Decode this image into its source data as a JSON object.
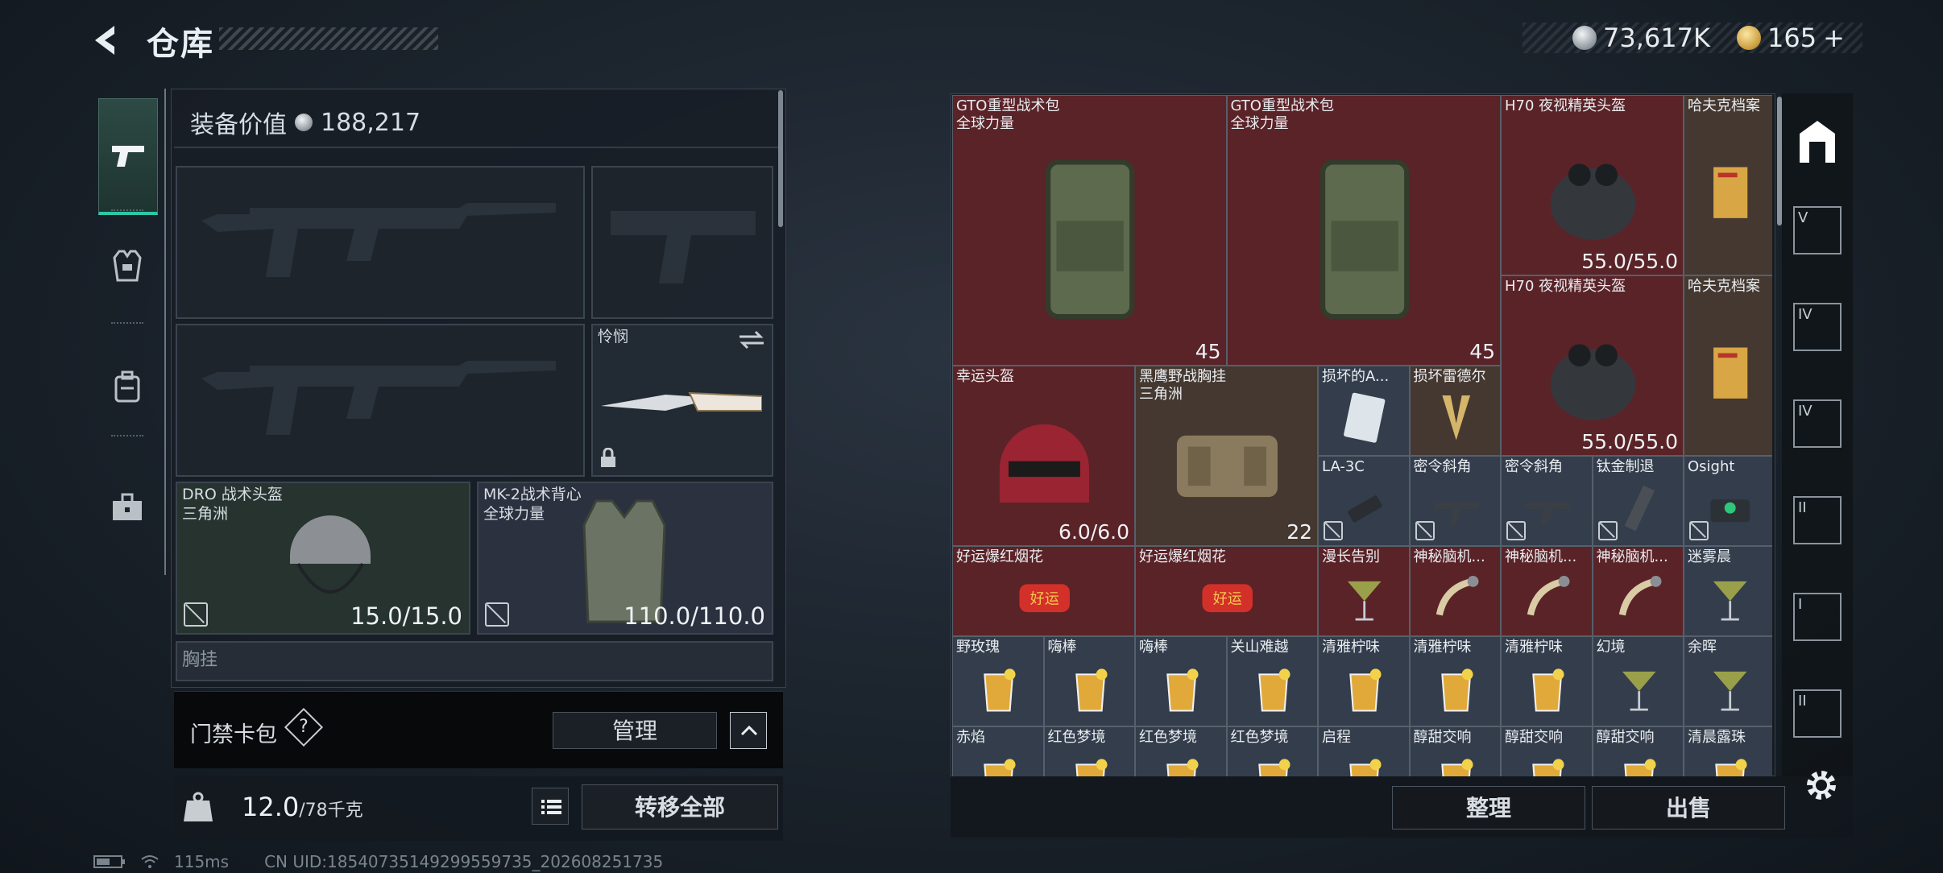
{
  "header": {
    "title": "仓库",
    "currency_silver": "73,617K",
    "currency_gold": "165",
    "gold_add": "+"
  },
  "left_tabs": [
    "weapons-tab",
    "armor-tab",
    "backpack-tab",
    "toolbox-tab"
  ],
  "equipment": {
    "value_label": "装备价值",
    "value": "188,217",
    "knife_name": "怜悯",
    "helmet": {
      "name": "DRO 战术头盔",
      "faction": "三角洲",
      "durability": "15.0/15.0"
    },
    "vest": {
      "name": "MK-2战术背心",
      "faction": "全球力量",
      "durability": "110.0/110.0"
    },
    "chest_rig_cut": "胸挂"
  },
  "gate_card": {
    "label": "门禁卡包",
    "help": "?",
    "manage": "管理"
  },
  "weight": {
    "value": "12.0",
    "capacity": "/78千克"
  },
  "transfer_all": "转移全部",
  "status": {
    "ping": "115ms",
    "uid": "CN UID:18540735149299559735_202608251735"
  },
  "stash": {
    "sort": "整理",
    "sell": "出售",
    "items": [
      {
        "name": "GTO重型战术包",
        "sub": "全球力量",
        "count": "45",
        "color": "red",
        "icon": "backpack-icon"
      },
      {
        "name": "GTO重型战术包",
        "sub": "全球力量",
        "count": "45",
        "color": "red",
        "icon": "backpack-icon"
      },
      {
        "name": "H70 夜视精英头盔",
        "sub": "",
        "count": "55.0/55.0",
        "color": "red",
        "icon": "nvg-helmet-icon"
      },
      {
        "name": "哈夫克档案",
        "sub": "",
        "count": "",
        "color": "brown",
        "icon": "folder-icon"
      },
      {
        "name": "H70 夜视精英头盔",
        "sub": "",
        "count": "55.0/55.0",
        "color": "red",
        "icon": "nvg-helmet-icon"
      },
      {
        "name": "哈夫克档案",
        "sub": "",
        "count": "",
        "color": "brown",
        "icon": "folder-icon"
      },
      {
        "name": "幸运头盔",
        "sub": "",
        "count": "6.0/6.0",
        "color": "red",
        "icon": "helmet-icon"
      },
      {
        "name": "黑鹰野战胸挂",
        "sub": "三角洲",
        "count": "22",
        "color": "brown",
        "icon": "chest-rig-icon"
      },
      {
        "name": "损坏的A...",
        "sub": "",
        "count": "",
        "color": "slate",
        "icon": "keycard-icon"
      },
      {
        "name": "损坏雷德尔",
        "sub": "",
        "count": "",
        "color": "brown",
        "icon": "blade-icon"
      },
      {
        "name": "LA-3C",
        "sub": "",
        "count": "",
        "color": "slate",
        "icon": "laser-icon"
      },
      {
        "name": "密令斜角",
        "sub": "",
        "count": "",
        "color": "slate",
        "icon": "grip-icon"
      },
      {
        "name": "密令斜角",
        "sub": "",
        "count": "",
        "color": "slate",
        "icon": "grip-icon"
      },
      {
        "name": "钛金制退",
        "sub": "",
        "count": "",
        "color": "slate",
        "icon": "muzzle-icon"
      },
      {
        "name": "Osight",
        "sub": "",
        "count": "",
        "color": "slate",
        "icon": "sight-icon"
      },
      {
        "name": "好运爆红烟花",
        "sub": "",
        "count": "",
        "color": "red",
        "icon": "firework-icon"
      },
      {
        "name": "好运爆红烟花",
        "sub": "",
        "count": "",
        "color": "red",
        "icon": "firework-icon"
      },
      {
        "name": "漫长告别",
        "sub": "",
        "count": "",
        "color": "red",
        "icon": "cocktail-icon"
      },
      {
        "name": "神秘脑机...",
        "sub": "",
        "count": "",
        "color": "red",
        "icon": "device-icon"
      },
      {
        "name": "神秘脑机...",
        "sub": "",
        "count": "",
        "color": "red",
        "icon": "device-icon"
      },
      {
        "name": "神秘脑机...",
        "sub": "",
        "count": "",
        "color": "red",
        "icon": "device-icon"
      },
      {
        "name": "迷雾晨",
        "sub": "",
        "count": "",
        "color": "slate",
        "icon": "cocktail-icon"
      },
      {
        "name": "野玫瑰",
        "sub": "",
        "count": "",
        "color": "slate",
        "icon": "drink-icon"
      },
      {
        "name": "嗨棒",
        "sub": "",
        "count": "",
        "color": "slate",
        "icon": "drink-icon"
      },
      {
        "name": "嗨棒",
        "sub": "",
        "count": "",
        "color": "slate",
        "icon": "drink-icon"
      },
      {
        "name": "关山难越",
        "sub": "",
        "count": "",
        "color": "slate",
        "icon": "drink-icon"
      },
      {
        "name": "清雅柠味",
        "sub": "",
        "count": "",
        "color": "slate",
        "icon": "drink-icon"
      },
      {
        "name": "清雅柠味",
        "sub": "",
        "count": "",
        "color": "slate",
        "icon": "drink-icon"
      },
      {
        "name": "清雅柠味",
        "sub": "",
        "count": "",
        "color": "slate",
        "icon": "drink-icon"
      },
      {
        "name": "幻境",
        "sub": "",
        "count": "",
        "color": "slate",
        "icon": "cocktail-icon"
      },
      {
        "name": "余晖",
        "sub": "",
        "count": "",
        "color": "slate",
        "icon": "cocktail-icon"
      },
      {
        "name": "赤焰",
        "sub": "",
        "count": "",
        "color": "slate",
        "icon": "drink-icon"
      },
      {
        "name": "红色梦境",
        "sub": "",
        "count": "",
        "color": "slate",
        "icon": "drink-icon"
      },
      {
        "name": "红色梦境",
        "sub": "",
        "count": "",
        "color": "slate",
        "icon": "drink-icon"
      },
      {
        "name": "红色梦境",
        "sub": "",
        "count": "",
        "color": "slate",
        "icon": "drink-icon"
      },
      {
        "name": "启程",
        "sub": "",
        "count": "",
        "color": "slate",
        "icon": "drink-icon"
      },
      {
        "name": "醇甜交响",
        "sub": "",
        "count": "",
        "color": "slate",
        "icon": "drink-icon"
      },
      {
        "name": "醇甜交响",
        "sub": "",
        "count": "",
        "color": "slate",
        "icon": "drink-icon"
      },
      {
        "name": "醇甜交响",
        "sub": "",
        "count": "",
        "color": "slate",
        "icon": "drink-icon"
      },
      {
        "name": "清晨露珠",
        "sub": "",
        "count": "",
        "color": "slate",
        "icon": "drink-icon"
      }
    ]
  },
  "right_tabs": {
    "tier_labels": [
      "V",
      "IV",
      "IV",
      "II",
      "I",
      "II"
    ]
  }
}
